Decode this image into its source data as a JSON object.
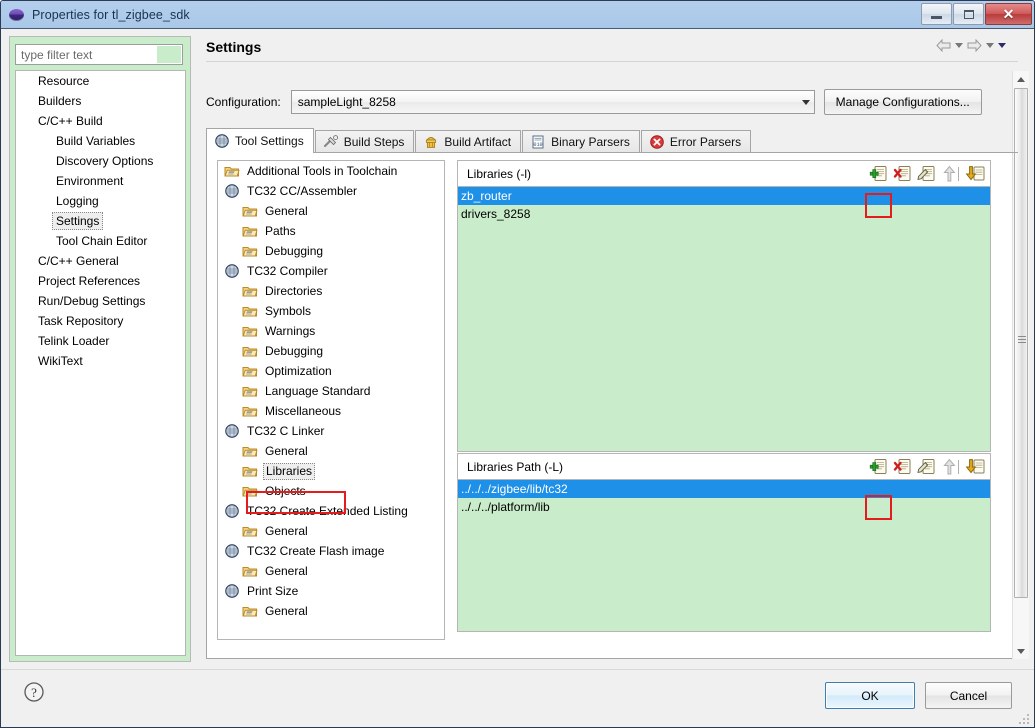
{
  "window": {
    "title": "Properties for tl_zigbee_sdk",
    "icon": "eclipse-globe-icon",
    "buttons": {
      "minimize": "minimize-button",
      "maximize": "maximize-button",
      "close": "✕"
    }
  },
  "filter": {
    "placeholder": "type filter text",
    "value": ""
  },
  "sidebar": {
    "items": [
      {
        "label": "Resource",
        "indent": 0,
        "selected": false
      },
      {
        "label": "Builders",
        "indent": 0,
        "selected": false
      },
      {
        "label": "C/C++ Build",
        "indent": 0,
        "selected": false
      },
      {
        "label": "Build Variables",
        "indent": 1,
        "selected": false
      },
      {
        "label": "Discovery Options",
        "indent": 1,
        "selected": false
      },
      {
        "label": "Environment",
        "indent": 1,
        "selected": false
      },
      {
        "label": "Logging",
        "indent": 1,
        "selected": false
      },
      {
        "label": "Settings",
        "indent": 1,
        "selected": true
      },
      {
        "label": "Tool Chain Editor",
        "indent": 1,
        "selected": false
      },
      {
        "label": "C/C++ General",
        "indent": 0,
        "selected": false
      },
      {
        "label": "Project References",
        "indent": 0,
        "selected": false
      },
      {
        "label": "Run/Debug Settings",
        "indent": 0,
        "selected": false
      },
      {
        "label": "Task Repository",
        "indent": 0,
        "selected": false
      },
      {
        "label": "Telink Loader",
        "indent": 0,
        "selected": false
      },
      {
        "label": "WikiText",
        "indent": 0,
        "selected": false
      }
    ]
  },
  "page": {
    "title": "Settings",
    "nav": {
      "back": "back-arrow-icon",
      "back_menu": "back-dropdown-icon",
      "forward": "forward-arrow-icon",
      "forward_menu": "forward-dropdown-icon",
      "view_menu": "view-menu-icon"
    }
  },
  "configuration": {
    "label": "Configuration:",
    "value": "sampleLight_8258",
    "manage_label": "Manage Configurations..."
  },
  "tabs": [
    {
      "label": "Tool Settings",
      "icon": "tool-settings-icon",
      "active": true
    },
    {
      "label": "Build Steps",
      "icon": "build-steps-icon",
      "active": false
    },
    {
      "label": "Build Artifact",
      "icon": "build-artifact-icon",
      "active": false
    },
    {
      "label": "Binary Parsers",
      "icon": "binary-parsers-icon",
      "active": false
    },
    {
      "label": "Error Parsers",
      "icon": "error-parsers-icon",
      "active": false
    }
  ],
  "toolchain_tree": [
    {
      "label": "Additional Tools in Toolchain",
      "indent": 0,
      "icon": "folder-icon",
      "selected": false
    },
    {
      "label": "TC32 CC/Assembler",
      "indent": 0,
      "icon": "tool-icon",
      "selected": false
    },
    {
      "label": "General",
      "indent": 1,
      "icon": "folder-icon",
      "selected": false
    },
    {
      "label": "Paths",
      "indent": 1,
      "icon": "folder-icon",
      "selected": false
    },
    {
      "label": "Debugging",
      "indent": 1,
      "icon": "folder-icon",
      "selected": false
    },
    {
      "label": "TC32 Compiler",
      "indent": 0,
      "icon": "tool-icon",
      "selected": false
    },
    {
      "label": "Directories",
      "indent": 1,
      "icon": "folder-icon",
      "selected": false
    },
    {
      "label": "Symbols",
      "indent": 1,
      "icon": "folder-icon",
      "selected": false
    },
    {
      "label": "Warnings",
      "indent": 1,
      "icon": "folder-icon",
      "selected": false
    },
    {
      "label": "Debugging",
      "indent": 1,
      "icon": "folder-icon",
      "selected": false
    },
    {
      "label": "Optimization",
      "indent": 1,
      "icon": "folder-icon",
      "selected": false
    },
    {
      "label": "Language Standard",
      "indent": 1,
      "icon": "folder-icon",
      "selected": false
    },
    {
      "label": "Miscellaneous",
      "indent": 1,
      "icon": "folder-icon",
      "selected": false
    },
    {
      "label": "TC32 C Linker",
      "indent": 0,
      "icon": "tool-icon",
      "selected": false
    },
    {
      "label": "General",
      "indent": 1,
      "icon": "folder-icon",
      "selected": false
    },
    {
      "label": "Libraries",
      "indent": 1,
      "icon": "folder-icon",
      "selected": true
    },
    {
      "label": "Objects",
      "indent": 1,
      "icon": "folder-icon",
      "selected": false
    },
    {
      "label": "TC32 Create Extended Listing",
      "indent": 0,
      "icon": "tool-icon",
      "selected": false
    },
    {
      "label": "General",
      "indent": 1,
      "icon": "folder-icon",
      "selected": false
    },
    {
      "label": "TC32 Create Flash image",
      "indent": 0,
      "icon": "tool-icon",
      "selected": false
    },
    {
      "label": "General",
      "indent": 1,
      "icon": "folder-icon",
      "selected": false
    },
    {
      "label": "Print Size",
      "indent": 0,
      "icon": "tool-icon",
      "selected": false
    },
    {
      "label": "General",
      "indent": 1,
      "icon": "folder-icon",
      "selected": false
    }
  ],
  "libraries": {
    "title": "Libraries (-l)",
    "toolbar": [
      {
        "name": "add-icon",
        "enabled": true
      },
      {
        "name": "delete-icon",
        "enabled": true
      },
      {
        "name": "edit-icon",
        "enabled": true
      },
      {
        "name": "move-up-icon",
        "enabled": false
      },
      {
        "name": "move-down-icon",
        "enabled": true
      }
    ],
    "items": [
      {
        "value": "zb_router",
        "selected": true
      },
      {
        "value": "drivers_8258",
        "selected": false
      }
    ]
  },
  "libraries_path": {
    "title": "Libraries Path (-L)",
    "toolbar": [
      {
        "name": "add-icon",
        "enabled": true
      },
      {
        "name": "delete-icon",
        "enabled": true
      },
      {
        "name": "edit-icon",
        "enabled": true
      },
      {
        "name": "move-up-icon",
        "enabled": false
      },
      {
        "name": "move-down-icon",
        "enabled": true
      }
    ],
    "items": [
      {
        "value": "../../../zigbee/lib/tc32",
        "selected": true
      },
      {
        "value": "../../../platform/lib",
        "selected": false
      }
    ]
  },
  "footer": {
    "help": "help-icon",
    "ok_label": "OK",
    "cancel_label": "Cancel"
  },
  "colors": {
    "titlebar": "#aecbea",
    "list_background": "#c9ecca",
    "selection": "#1e90e8",
    "highlight_box": "#e51c1c"
  }
}
